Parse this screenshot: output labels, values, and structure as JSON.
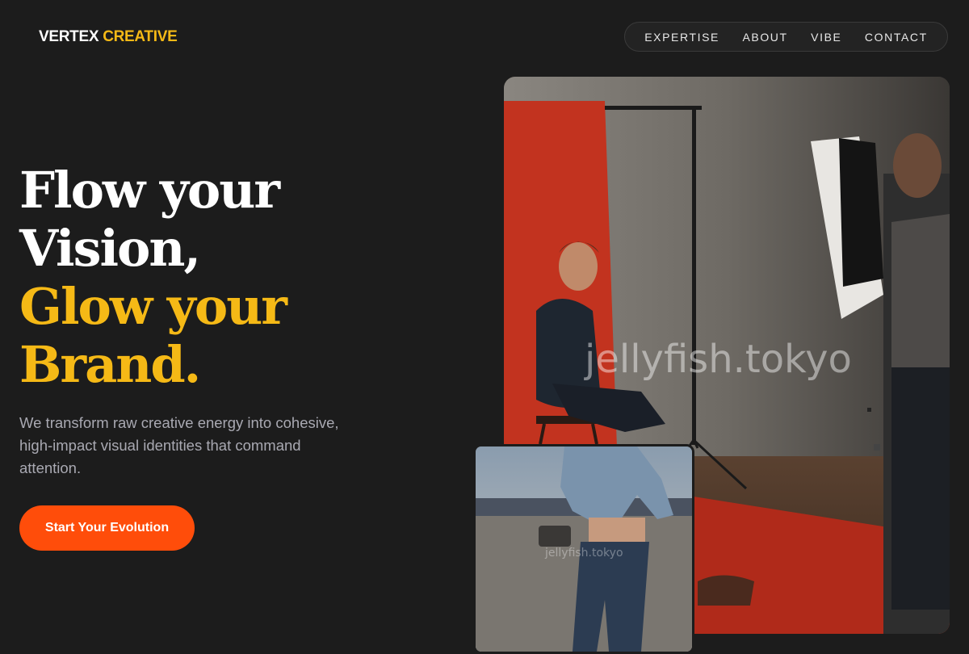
{
  "brand": {
    "name": "VERTEX",
    "accent": "CREATIVE"
  },
  "nav": {
    "items": [
      "EXPERTISE",
      "ABOUT",
      "VIBE",
      "CONTACT"
    ]
  },
  "hero": {
    "line1": "Flow your",
    "line2": "Vision,",
    "line3": "Glow your",
    "line4": "Brand.",
    "subtitle": "We transform raw creative energy into cohesive, high-impact visual identities that command attention.",
    "cta": "Start Your Evolution"
  },
  "images": {
    "main_watermark": "jellyfish.tokyo",
    "inset_watermark": "jellyfish.tokyo"
  },
  "colors": {
    "background": "#1c1c1c",
    "accent_gold": "#f5b916",
    "cta_orange": "#ff4d0a",
    "subtitle_gray": "#a9a9b2"
  }
}
